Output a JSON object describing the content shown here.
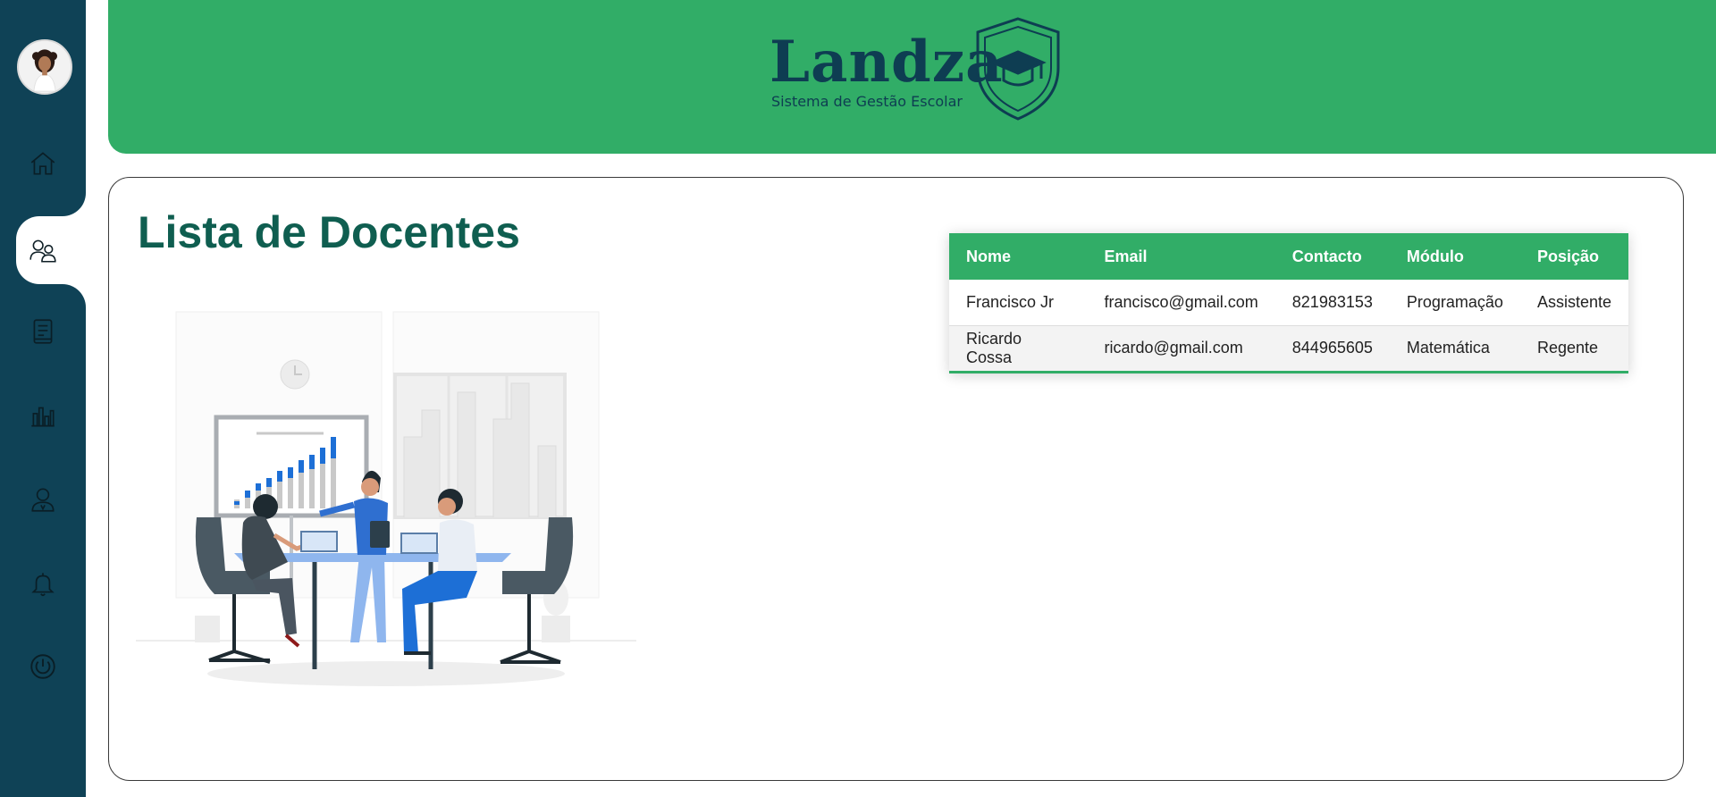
{
  "sidebar": {
    "avatar_alt": "user-avatar",
    "items": [
      {
        "name": "home",
        "icon": "home-icon"
      },
      {
        "name": "docentes",
        "icon": "users-icon",
        "active": true
      },
      {
        "name": "documents",
        "icon": "book-icon"
      },
      {
        "name": "statistics",
        "icon": "bar-chart-icon"
      },
      {
        "name": "profile",
        "icon": "user-icon"
      },
      {
        "name": "notifications",
        "icon": "bell-icon"
      },
      {
        "name": "logout",
        "icon": "power-icon"
      }
    ]
  },
  "header": {
    "brand": "Landza",
    "tagline": "Sistema de Gestão Escolar",
    "logo_icon": "shield-graduation-cap-icon"
  },
  "main": {
    "title": "Lista de Docentes",
    "table": {
      "columns": [
        "Nome",
        "Email",
        "Contacto",
        "Módulo",
        "Posição"
      ],
      "rows": [
        [
          "Francisco Jr",
          "francisco@gmail.com",
          "821983153",
          "Programação",
          "Assistente"
        ],
        [
          "Ricardo Cossa",
          "ricardo@gmail.com",
          "844965605",
          "Matemática",
          "Regente"
        ]
      ]
    }
  },
  "colors": {
    "sidebar": "#0f4256",
    "accent": "#31ad67",
    "title": "#0f5e50",
    "brand": "#0e3d52"
  }
}
